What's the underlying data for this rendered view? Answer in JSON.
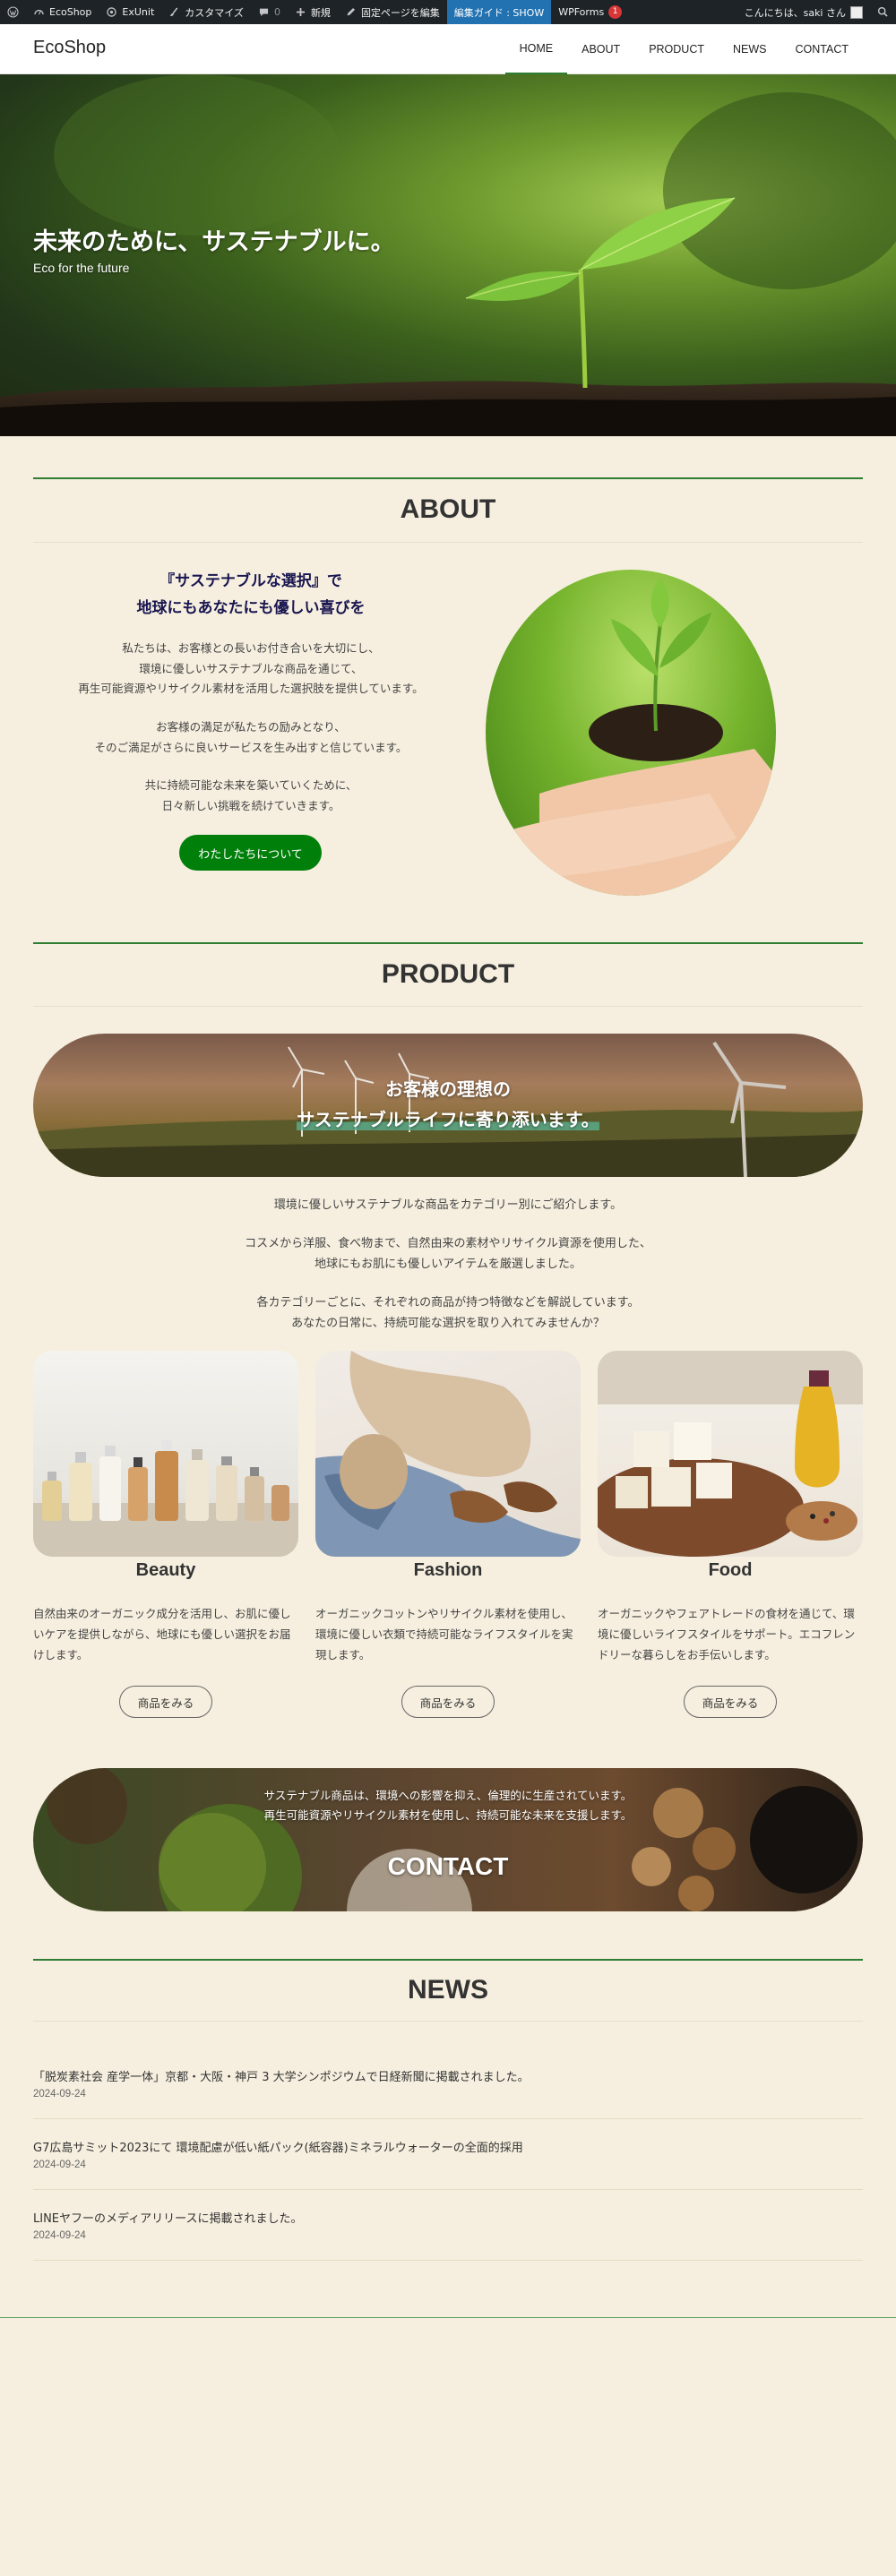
{
  "admin_bar": {
    "site": "EcoShop",
    "exunit": "ExUnit",
    "customize": "カスタマイズ",
    "comments": "0",
    "new": "新規",
    "edit": "固定ページを編集",
    "guide": "編集ガイド : SHOW",
    "wpforms": "WPForms",
    "wpforms_badge": "1",
    "greeting": "こんにちは、saki さん"
  },
  "header": {
    "site_title": "EcoShop",
    "nav": [
      "HOME",
      "ABOUT",
      "PRODUCT",
      "NEWS",
      "CONTACT"
    ]
  },
  "hero": {
    "title": "未来のために、サステナブルに。",
    "subtitle": "Eco for the future"
  },
  "about": {
    "title": "ABOUT",
    "heading_line1": "『サステナブルな選択』で",
    "heading_line2": "地球にもあなたにも優しい喜びを",
    "p1_l1": "私たちは、お客様との長いお付き合いを大切にし、",
    "p1_l2": "環境に優しいサステナブルな商品を通じて、",
    "p1_l3": "再生可能資源やリサイクル素材を活用した選択肢を提供しています。",
    "p2_l1": "お客様の満足が私たちの励みとなり、",
    "p2_l2": "そのご満足がさらに良いサービスを生み出すと信じています。",
    "p3_l1": "共に持続可能な未来を築いていくために、",
    "p3_l2": "日々新しい挑戦を続けていきます。",
    "button": "わたしたちについて"
  },
  "product": {
    "title": "PRODUCT",
    "banner_l1": "お客様の理想の",
    "banner_l2": "サステナブルライフに寄り添います。",
    "intro1": "環境に優しいサステナブルな商品をカテゴリー別にご紹介します。",
    "intro2_l1": "コスメから洋服、食べ物まで、自然由来の素材やリサイクル資源を使用した、",
    "intro2_l2": "地球にもお肌にも優しいアイテムを厳選しました。",
    "intro3_l1": "各カテゴリーごとに、それぞれの商品が持つ特徴などを解説しています。",
    "intro3_l2": "あなたの日常に、持続可能な選択を取り入れてみませんか？",
    "cards": [
      {
        "name": "Beauty",
        "desc": "自然由来のオーガニック成分を活用し、お肌に優しいケアを提供しながら、地球にも優しい選択をお届けします。",
        "button": "商品をみる"
      },
      {
        "name": "Fashion",
        "desc": "オーガニックコットンやリサイクル素材を使用し、環境に優しい衣類で持続可能なライフスタイルを実現します。",
        "button": "商品をみる"
      },
      {
        "name": "Food",
        "desc": "オーガニックやフェアトレードの食材を通じて、環境に優しいライフスタイルをサポート。エコフレンドリーな暮らしをお手伝いします。",
        "button": "商品をみる"
      }
    ]
  },
  "contact_banner": {
    "line1": "サステナブル商品は、環境への影響を抑え、倫理的に生産されています。",
    "line2": "再生可能資源やリサイクル素材を使用し、持続可能な未来を支援します。",
    "title": "CONTACT"
  },
  "news": {
    "title": "NEWS",
    "items": [
      {
        "title": "「脱炭素社会 産学一体」京都・大阪・神戸 3 大学シンポジウムで日経新聞に掲載されました。",
        "date": "2024-09-24"
      },
      {
        "title": "G7広島サミット2023にて 環境配慮が低い紙パック(紙容器)ミネラルウォーターの全面的採用",
        "date": "2024-09-24"
      },
      {
        "title": "LINEヤフーのメディアリリースに掲載されました。",
        "date": "2024-09-24"
      }
    ]
  },
  "colors": {
    "accent_green": "#2e7d32",
    "button_green": "#00800a",
    "background": "#f6efdf",
    "heading_navy": "#191650",
    "admin_bar": "#1d2327",
    "guide_blue": "#2271b1"
  }
}
